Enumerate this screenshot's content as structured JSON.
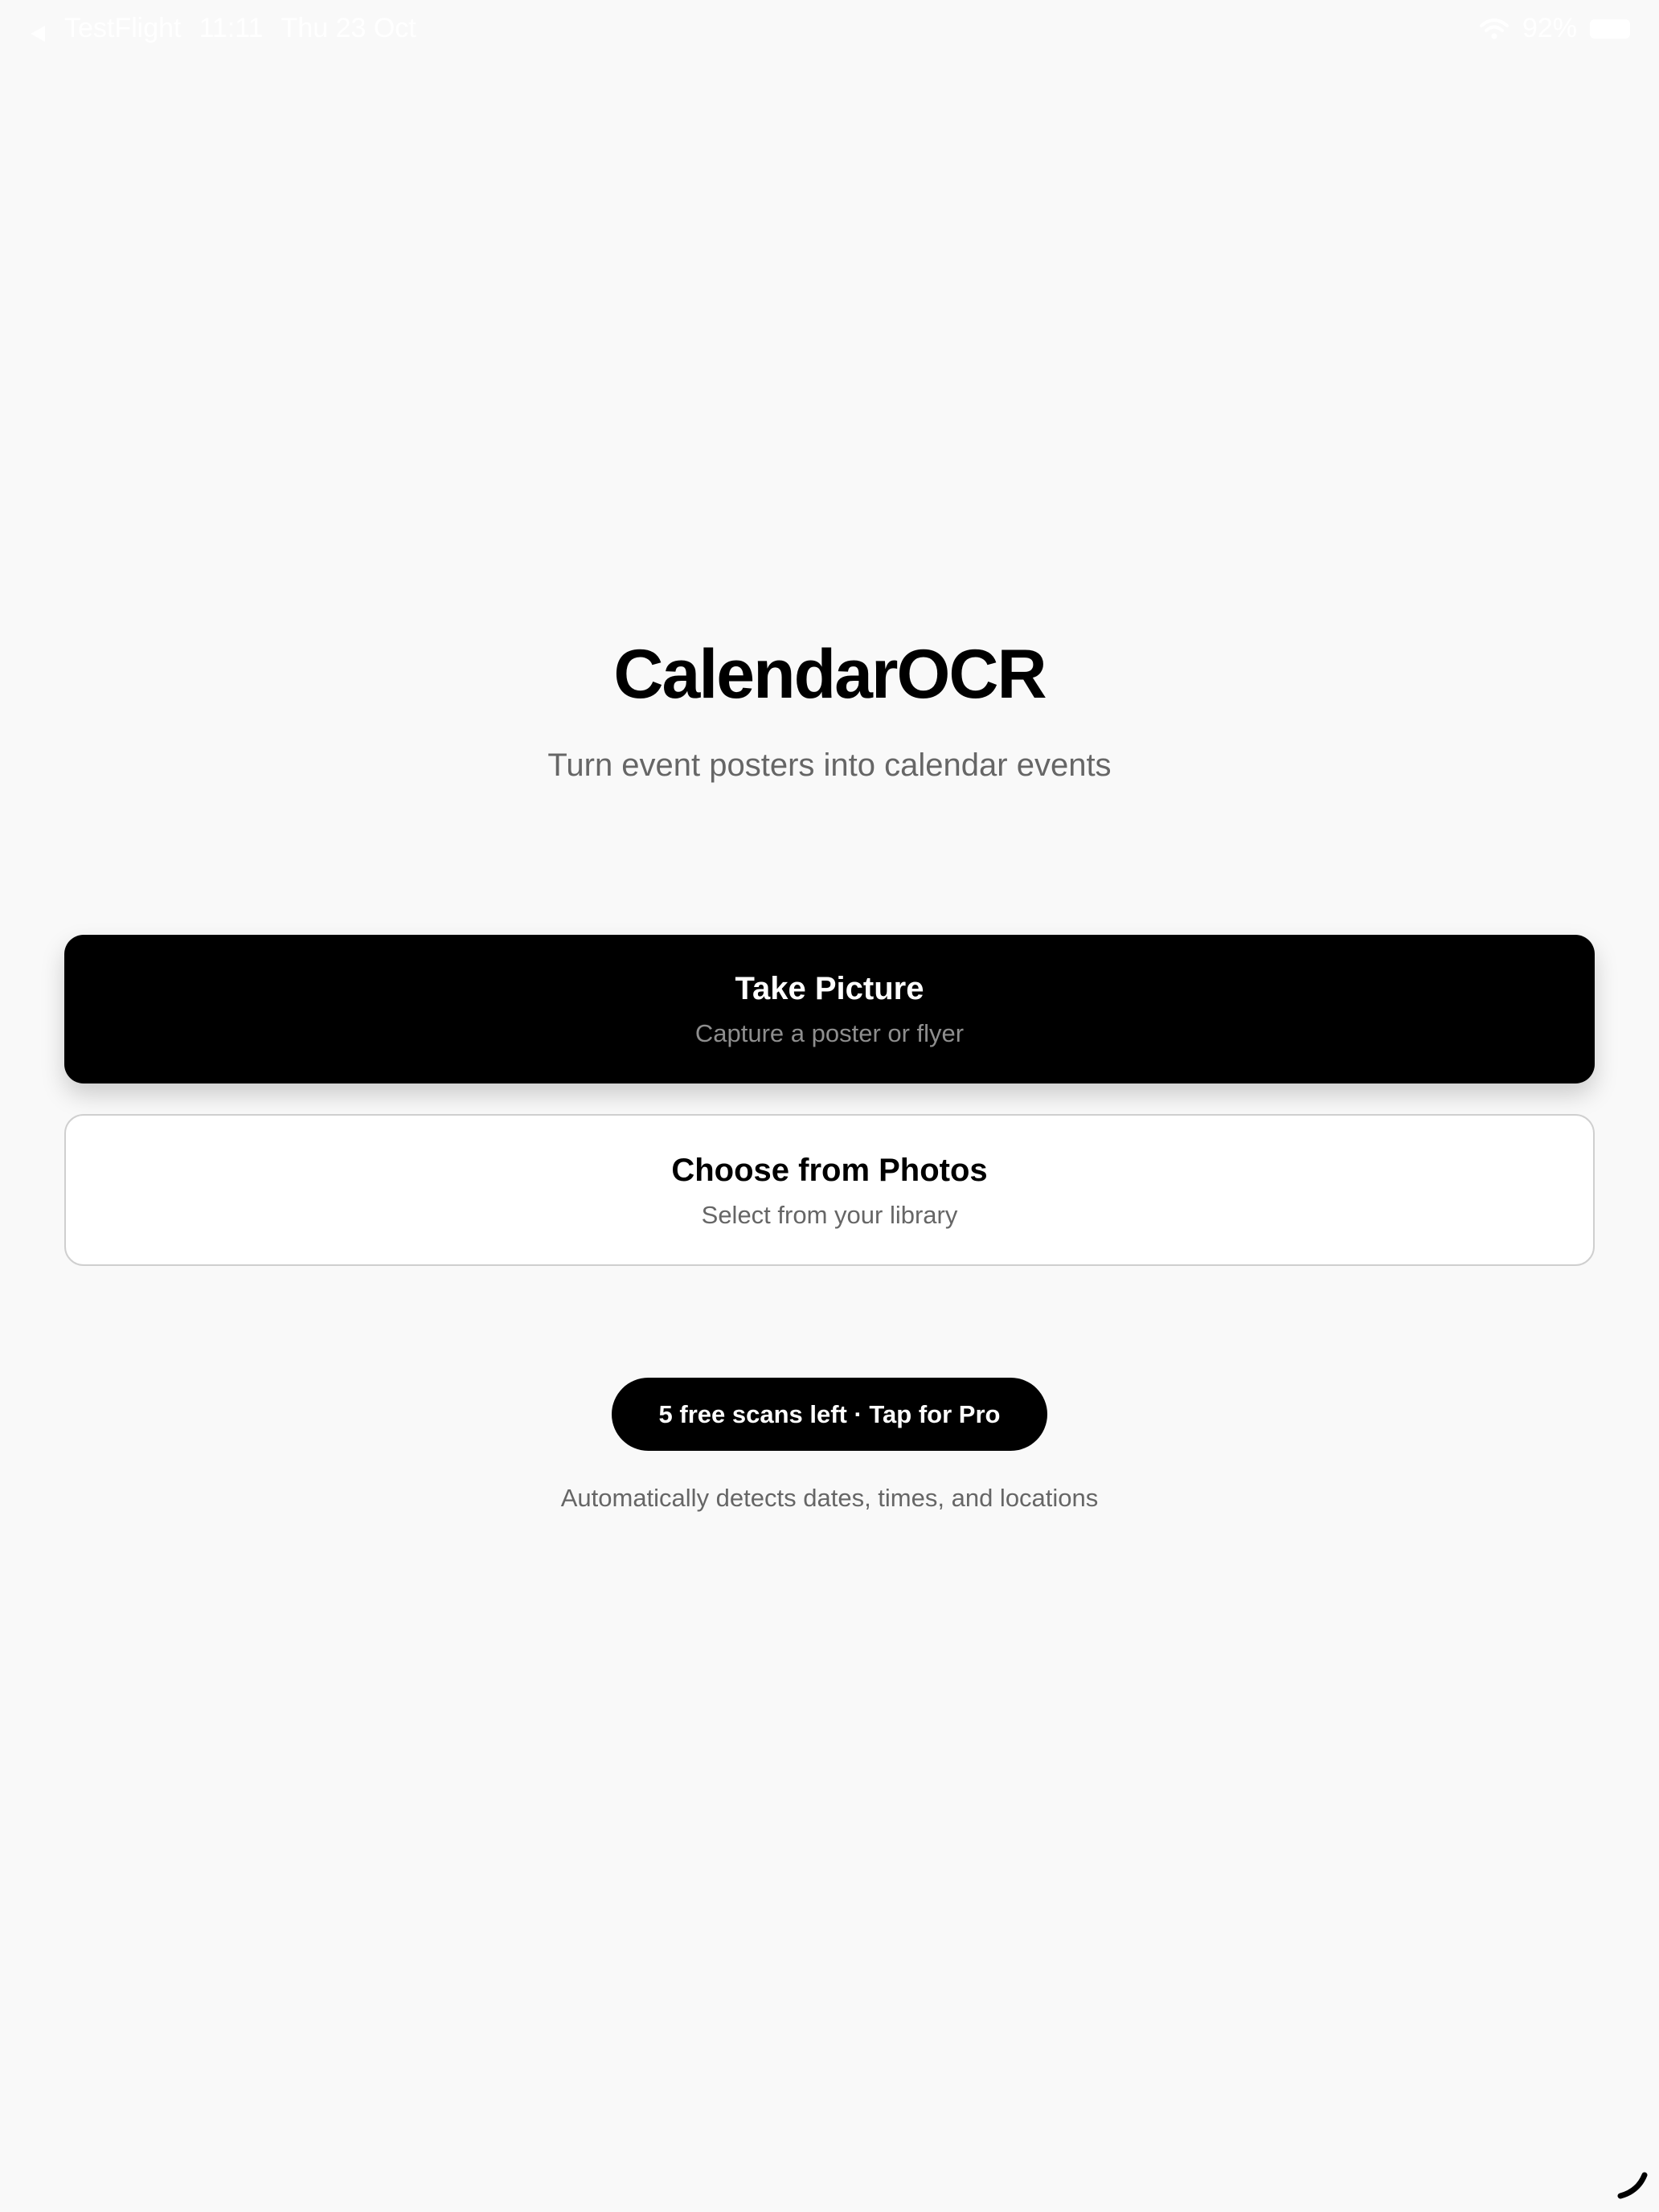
{
  "status_bar": {
    "back_label": "TestFlight",
    "time": "11:11",
    "date": "Thu 23 Oct",
    "battery": "92%",
    "icons": [
      "back-arrow-icon",
      "wifi-icon",
      "battery-icon"
    ]
  },
  "header": {
    "title": "CalendarOCR",
    "subtitle": "Turn event posters into calendar events"
  },
  "actions": {
    "take_picture": {
      "label": "Take Picture",
      "sublabel": "Capture a poster or flyer"
    },
    "choose_photos": {
      "label": "Choose from Photos",
      "sublabel": "Select from your library"
    }
  },
  "pro_banner": {
    "label": "5 free scans left · Tap for Pro"
  },
  "footnote": "Automatically detects dates, times, and locations",
  "colors": {
    "background": "#f9f9f9",
    "primary": "#000000",
    "secondary_text": "#666666",
    "card_border": "#cfcfcf"
  }
}
